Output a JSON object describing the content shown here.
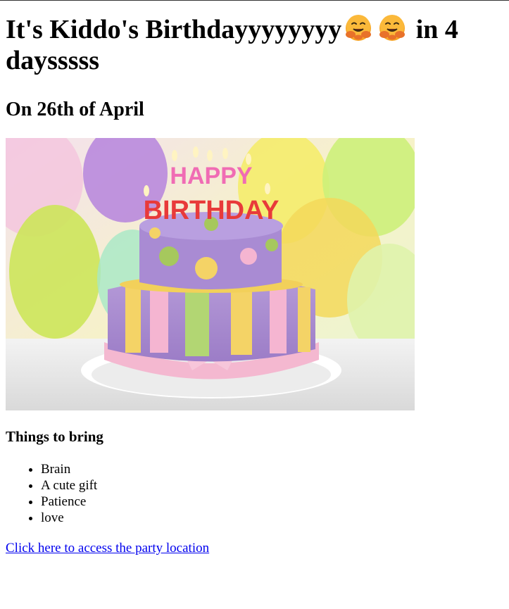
{
  "header": {
    "title_part1": "It's Kiddo's Birthdayyyyyyyy",
    "title_part2": "in 4 daysssss",
    "emoji_icon": "hugging-face-emoji-icon"
  },
  "subheader": {
    "date": "On 26th of April"
  },
  "hero": {
    "cake_text_top": "HAPPY",
    "cake_text_bottom": "BIRTHDAY"
  },
  "bring": {
    "title": "Things to bring",
    "items": [
      "Brain",
      "A cute gift",
      "Patience",
      "love"
    ]
  },
  "link": {
    "label": "Click here to access the party location"
  },
  "colors": {
    "link": "#0000ee",
    "text": "#000000",
    "emoji_face": "#f7a525"
  }
}
